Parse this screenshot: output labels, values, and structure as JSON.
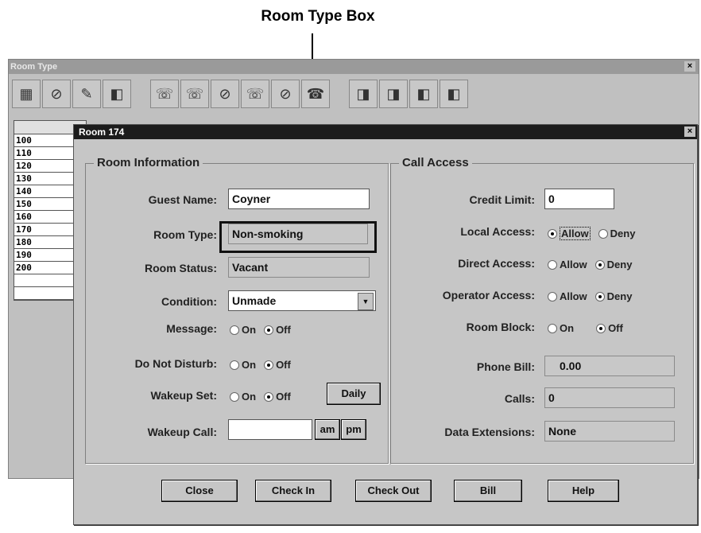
{
  "callout": {
    "label": "Room Type Box"
  },
  "bg_window": {
    "title": "Room Type",
    "close": "×",
    "toolbar_icons": [
      "guest-list-icon",
      "no-smoking-icon",
      "pen-icon",
      "door-sign-icon",
      "phone-allow-icon",
      "phone-deny-icon",
      "no-calls-icon",
      "wakeup-icon",
      "no-disturb-icon",
      "handset-icon",
      "room-on-icon",
      "room-off-icon",
      "block-icon",
      "unblock-icon"
    ],
    "list_rows": [
      "",
      "100",
      "110",
      "120",
      "130",
      "140",
      "150",
      "160",
      "170",
      "180",
      "190",
      "200",
      "",
      ""
    ]
  },
  "dialog": {
    "title": "Room 174",
    "close": "×",
    "room_info": {
      "group_title": "Room Information",
      "guest_name_label": "Guest Name:",
      "guest_name": "Coyner",
      "room_type_label": "Room Type:",
      "room_type": "Non-smoking",
      "room_status_label": "Room Status:",
      "room_status": "Vacant",
      "condition_label": "Condition:",
      "condition": "Unmade",
      "message_label": "Message:",
      "dnd_label": "Do Not Disturb:",
      "wakeup_set_label": "Wakeup Set:",
      "wakeup_call_label": "Wakeup Call:",
      "on": "On",
      "off": "Off",
      "daily": "Daily",
      "am": "am",
      "pm": "pm"
    },
    "call_access": {
      "group_title": "Call Access",
      "credit_limit_label": "Credit Limit:",
      "credit_limit": "0",
      "local_access_label": "Local Access:",
      "direct_access_label": "Direct Access:",
      "operator_access_label": "Operator Access:",
      "room_block_label": "Room Block:",
      "phone_bill_label": "Phone Bill:",
      "phone_bill": "0.00",
      "calls_label": "Calls:",
      "calls": "0",
      "data_ext_label": "Data Extensions:",
      "data_ext": "None",
      "allow": "Allow",
      "deny": "Deny",
      "on": "On",
      "off": "Off"
    },
    "buttons": {
      "close": "Close",
      "check_in": "Check In",
      "check_out": "Check Out",
      "bill": "Bill",
      "help": "Help"
    }
  }
}
